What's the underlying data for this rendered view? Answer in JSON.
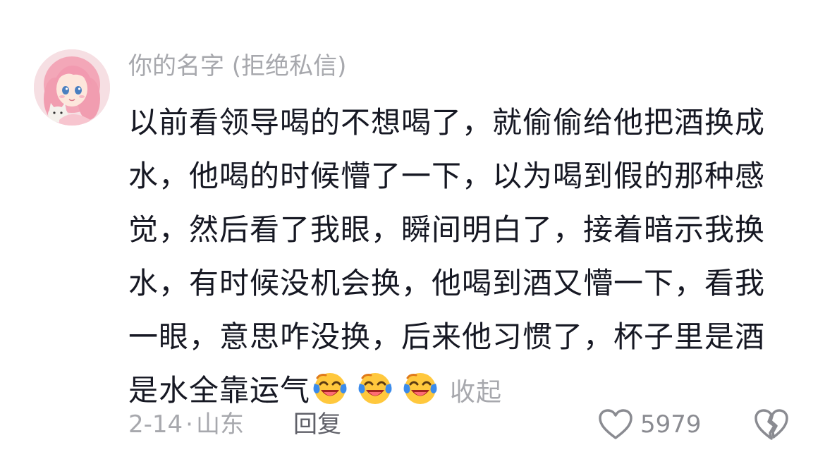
{
  "comment": {
    "username": "你的名字 (拒绝私信)",
    "avatar_icon": "avatar-anime-girl-with-cat",
    "content_lines": [
      "以前看领导喝的不想喝了，就偷偷给他把酒换成",
      "水，他喝的时候懵了一下，以为喝到假的那种感",
      "觉，然后看了我眼，瞬间明白了，接着暗示我换",
      "水，有时候没机会换，他喝到酒又懵一下，看我",
      "一眼，意思咋没换，后来他习惯了，杯子里是酒",
      "是水全靠运气"
    ],
    "emojis": [
      "laughing-crying-emoji",
      "laughing-crying-emoji",
      "laughing-crying-emoji"
    ],
    "collapse_label": "收起",
    "date": "2-14",
    "separator": "·",
    "location": "山东",
    "reply_label": "回复",
    "like_icon": "heart-outline-icon",
    "like_count": "5979",
    "dislike_icon": "broken-heart-icon"
  },
  "colors": {
    "text": "#161823",
    "muted": "#a7a8ad",
    "reply": "#5f6068",
    "emoji_face": "#ffc83d",
    "emoji_tear": "#3b8beb"
  }
}
